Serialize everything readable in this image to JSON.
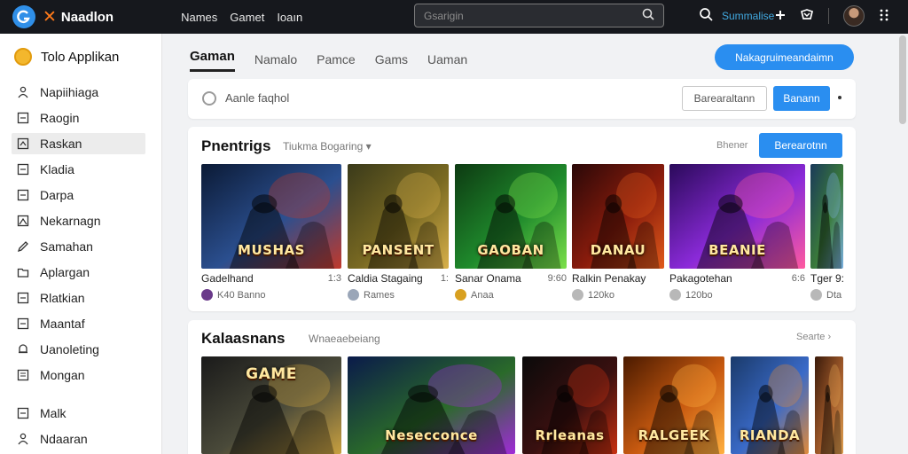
{
  "topbar": {
    "brand_name": "Naadlon",
    "nav": [
      "Names",
      "Gamet",
      "Ioaın"
    ],
    "search_placeholder": "Gsarigin",
    "link": "Summalise"
  },
  "sidebar": {
    "title": "Tolo Applikan",
    "items": [
      {
        "label": "Napiihiaga",
        "icon": "person-icon"
      },
      {
        "label": "Raogin",
        "icon": "square-icon"
      },
      {
        "label": "Raskan",
        "icon": "bookmark-icon",
        "active": true
      },
      {
        "label": "Kladia",
        "icon": "square-icon"
      },
      {
        "label": "Darpa",
        "icon": "square-icon"
      },
      {
        "label": "Nekarnagn",
        "icon": "image-icon"
      },
      {
        "label": "Samahan",
        "icon": "pen-icon"
      },
      {
        "label": "Aplargan",
        "icon": "folder-icon"
      },
      {
        "label": "Rlatkian",
        "icon": "square-icon"
      },
      {
        "label": "Maantaf",
        "icon": "square-icon"
      },
      {
        "label": "Uanoleting",
        "icon": "bell-icon"
      },
      {
        "label": "Mongan",
        "icon": "list-icon"
      }
    ],
    "bottom_items": [
      {
        "label": "Malk",
        "icon": "square-icon"
      },
      {
        "label": "Ndaaran",
        "icon": "person-icon"
      }
    ]
  },
  "tabs": [
    "Gaman",
    "Namalo",
    "Pamce",
    "Gams",
    "Uaman"
  ],
  "cta_label": "Nakagruimeandaimn",
  "filter": {
    "text": "Aanle faqhol",
    "btn_outline": "Barearaltann",
    "btn_blue": "Banann"
  },
  "section1": {
    "title": "Pnentrigs",
    "subtitle": "Tiukma Bogaring",
    "link": "Bhener",
    "button": "Berearotnn",
    "games": [
      {
        "thumb_text": "MUSHAS",
        "name": "Gadelhand",
        "num": "1:3",
        "meta": "K40 Banno"
      },
      {
        "thumb_text": "PANSENT",
        "name": "Caldia Stagaing",
        "num": "1:",
        "meta": "Rames"
      },
      {
        "thumb_text": "GAOBAN",
        "name": "Sanar Onama",
        "num": "9:60",
        "meta": "Anaa"
      },
      {
        "thumb_text": "DANAU",
        "name": "Ralkin Penakay",
        "num": "",
        "meta": "120ko"
      },
      {
        "thumb_text": "BEANIE",
        "name": "Pakagotehan",
        "num": "6:6",
        "meta": "120bo"
      },
      {
        "thumb_text": "",
        "name": "Tger 9:",
        "num": "",
        "meta": "Dta"
      }
    ]
  },
  "section2": {
    "title": "Kalaasnans",
    "subtitle": "Wnaeaebeiang",
    "link": "Searte",
    "games": [
      {
        "thumb_text": "GAME"
      },
      {
        "thumb_text": "Nesecconce"
      },
      {
        "thumb_text": "Rrleanas"
      },
      {
        "thumb_text": "RALGEEK"
      },
      {
        "thumb_text": "RIANDA"
      },
      {
        "thumb_text": ""
      }
    ]
  },
  "colors": {
    "accent": "#2a8ef0",
    "topbar": "#16181d",
    "brand_x": "#ff7a1a"
  }
}
